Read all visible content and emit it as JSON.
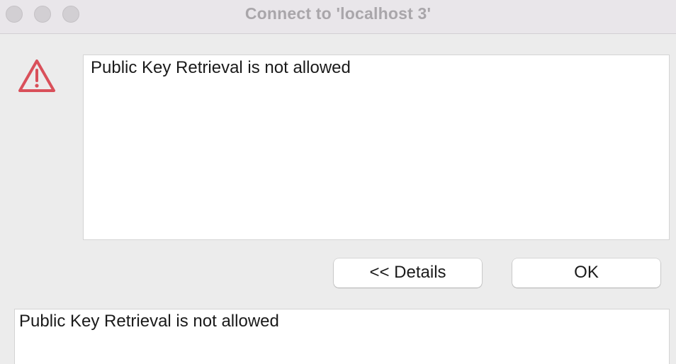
{
  "window": {
    "title": "Connect to 'localhost 3'"
  },
  "icons": {
    "alert": "warning-triangle-icon",
    "alert_color": "#d9505a"
  },
  "message": {
    "text": "Public Key Retrieval is not allowed"
  },
  "buttons": {
    "details_label": "<< Details",
    "ok_label": "OK"
  },
  "details": {
    "text": "Public Key Retrieval is not allowed"
  }
}
